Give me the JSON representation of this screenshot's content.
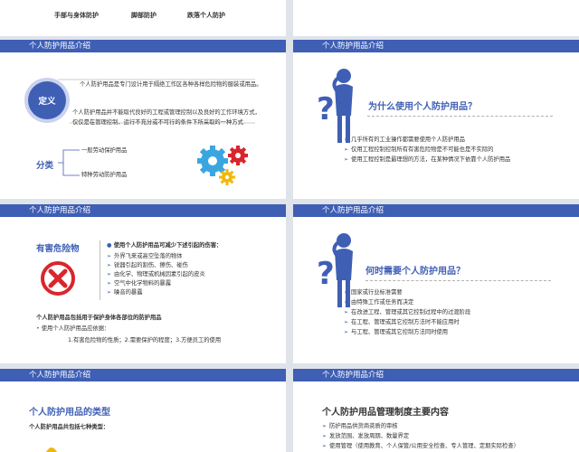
{
  "top_strip": {
    "items": [
      "手部与身体防护",
      "脚部防护",
      "跌落个人防护"
    ]
  },
  "slides": {
    "s1": {
      "header": "个人防护用品介绍",
      "badge": "定义",
      "def_para1": "个人防护用品是专门设计用于隔绝工作区各种各样危险物的服装或用品。",
      "def_para2_line1": "个人防护用品并不能取代良好的工程或管理控制以及良好的工作环境方式，",
      "def_para2_line2": "仅仅是在管理控制、运行不充分或不可行的条件下所采取的一种方式",
      "class_title": "分类",
      "class_item1": "一般劳动保护用品",
      "class_item2": "特种劳动防护用品"
    },
    "s2": {
      "header": "个人防护用品介绍",
      "question": "为什么使用个人防护用品？",
      "bullets": [
        "几乎所有的工业操作都需要使用个人防护用品",
        "仅用工程控制控制所有有害危险物是不可能也是不实际的",
        "使用工程控制是最理想的方法，在某种情况下依靠个人防护用品"
      ]
    },
    "s3": {
      "header": "个人防护用品介绍",
      "title": "有害危险物",
      "list_title": "使用个人防护用品可减少下述引起的伤害：",
      "list": [
        "外界飞来或高空坠落的物体",
        "锐器引起的割伤、擦伤、碰伤",
        "由化学、物理或机械因素引起的皮炎",
        "空气中化学物料的暴露",
        "噪音的暴露"
      ],
      "bottom_title": "个人防护用品包括用于保护身体各部位的防护用品",
      "bottom_sub": "使用个人防护用品应依据：",
      "bottom_detail": "1.有害危险物的性质；2.需要保护的程度；3.方便员工的使用"
    },
    "s4": {
      "header": "个人防护用品介绍",
      "question": "何时需要个人防护用品？",
      "bullets": [
        "国家或行业标准需要",
        "由特殊工作或任务而决定",
        "在改进工程、管理或其它控制过程中的过渡阶段",
        "在工程、管理或其它控制方法时不能应用时",
        "与工程、管理或其它控制方法同时使用"
      ]
    },
    "s5": {
      "header": "个人防护用品介绍",
      "title": "个人防护用品的类型",
      "subtitle": "个人防护用品共包括七种类型："
    },
    "s6": {
      "header": "个人防护用品介绍",
      "title": "个人防护用品管理制度主要内容",
      "bullets": [
        "防护用品供货商资质的审核",
        "发放范围、发放周期、数量界定",
        "使用管理（使用教育、个人保管/公用安全检查、专人管理、定期实际检查）"
      ]
    }
  },
  "colors": {
    "accent": "#3f5fb5",
    "slide_bg": "#ffffff",
    "gap_bg": "#dfe3ea",
    "danger": "#d9262c"
  }
}
